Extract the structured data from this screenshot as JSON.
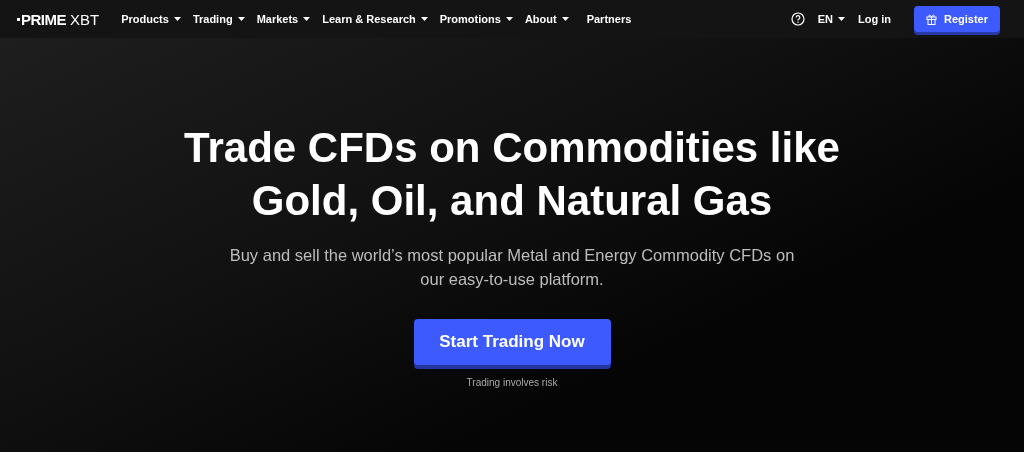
{
  "logo": {
    "primary": "PRIME",
    "secondary": "XBT"
  },
  "nav": [
    {
      "label": "Products",
      "dropdown": true
    },
    {
      "label": "Trading",
      "dropdown": true
    },
    {
      "label": "Markets",
      "dropdown": true
    },
    {
      "label": "Learn & Research",
      "dropdown": true
    },
    {
      "label": "Promotions",
      "dropdown": true
    },
    {
      "label": "About",
      "dropdown": true
    },
    {
      "label": "Partners",
      "dropdown": false
    }
  ],
  "language": "EN",
  "login": "Log in",
  "register": "Register",
  "hero": {
    "title": "Trade CFDs on Commodities like Gold, Oil, and Natural Gas",
    "subtitle": "Buy and sell the world’s most popular Metal and Energy Commodity CFDs on our easy-to-use platform.",
    "cta": "Start Trading Now",
    "note": "Trading involves risk"
  }
}
